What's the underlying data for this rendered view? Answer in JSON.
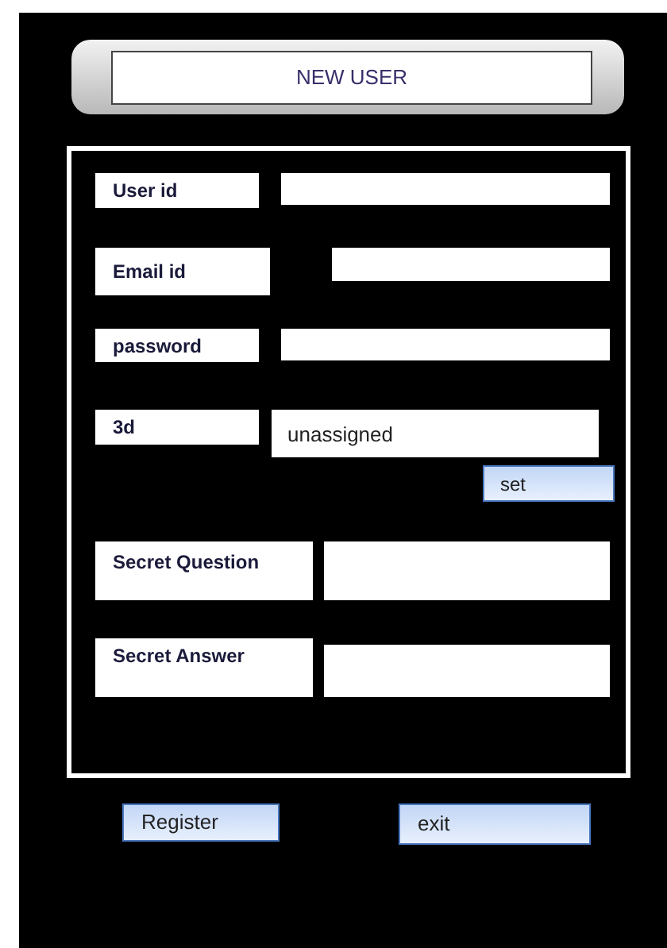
{
  "title": "NEW USER",
  "form": {
    "fields": [
      {
        "label": "User id"
      },
      {
        "label": "Email id"
      },
      {
        "label": "password"
      },
      {
        "label": "3d",
        "value": "unassigned",
        "button": "set"
      },
      {
        "label": "Secret Question"
      },
      {
        "label": "Secret Answer"
      }
    ]
  },
  "buttons": [
    "Register",
    "exit"
  ]
}
